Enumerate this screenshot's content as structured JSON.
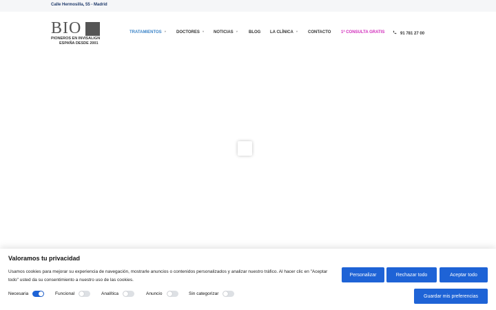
{
  "topbar": {
    "address": "Calle Hermosilla, 55 - Madrid"
  },
  "logo": {
    "brand": "BIO",
    "line1": "PIONEROS EN INVISALIGN",
    "line2": "ESPAÑA DESDE 2001"
  },
  "nav": {
    "items": [
      {
        "label": "TRATAMIENTOS",
        "dropdown": true,
        "active": true
      },
      {
        "label": "DOCTORES",
        "dropdown": true
      },
      {
        "label": "NOTICIAS",
        "dropdown": true
      },
      {
        "label": "BLOG",
        "dropdown": false
      },
      {
        "label": "LA CLÍNICA",
        "dropdown": true
      },
      {
        "label": "CONTACTO",
        "dropdown": false
      },
      {
        "label": "1ª CONSULTA GRATIS",
        "dropdown": false,
        "promo": true
      }
    ],
    "phone": "91 781 27 00",
    "caret": "˅"
  },
  "cookie": {
    "title": "Valoramos tu privacidad",
    "text": "Usamos cookies para mejorar su experiencia de navegación, mostrarle anuncios o contenidos personalizados y analizar nuestro tráfico. Al hacer clic en \"Aceptar todo\" usted da su consentimiento a nuestro uso de las cookies.",
    "buttons": {
      "customize": "Personalizar",
      "reject": "Rechazar todo",
      "accept": "Aceptar todo",
      "save": "Guardar mis preferencias"
    },
    "toggles": [
      {
        "label": "Necesaria",
        "on": true
      },
      {
        "label": "Funcional",
        "on": false
      },
      {
        "label": "Analítica",
        "on": false
      },
      {
        "label": "Anuncio",
        "on": false
      },
      {
        "label": "Sin categorizar",
        "on": false
      }
    ]
  },
  "colors": {
    "accent": "#1e63d6",
    "nav_active": "#3a83c7",
    "promo": "#d12bbb",
    "address": "#1f3a6b"
  }
}
